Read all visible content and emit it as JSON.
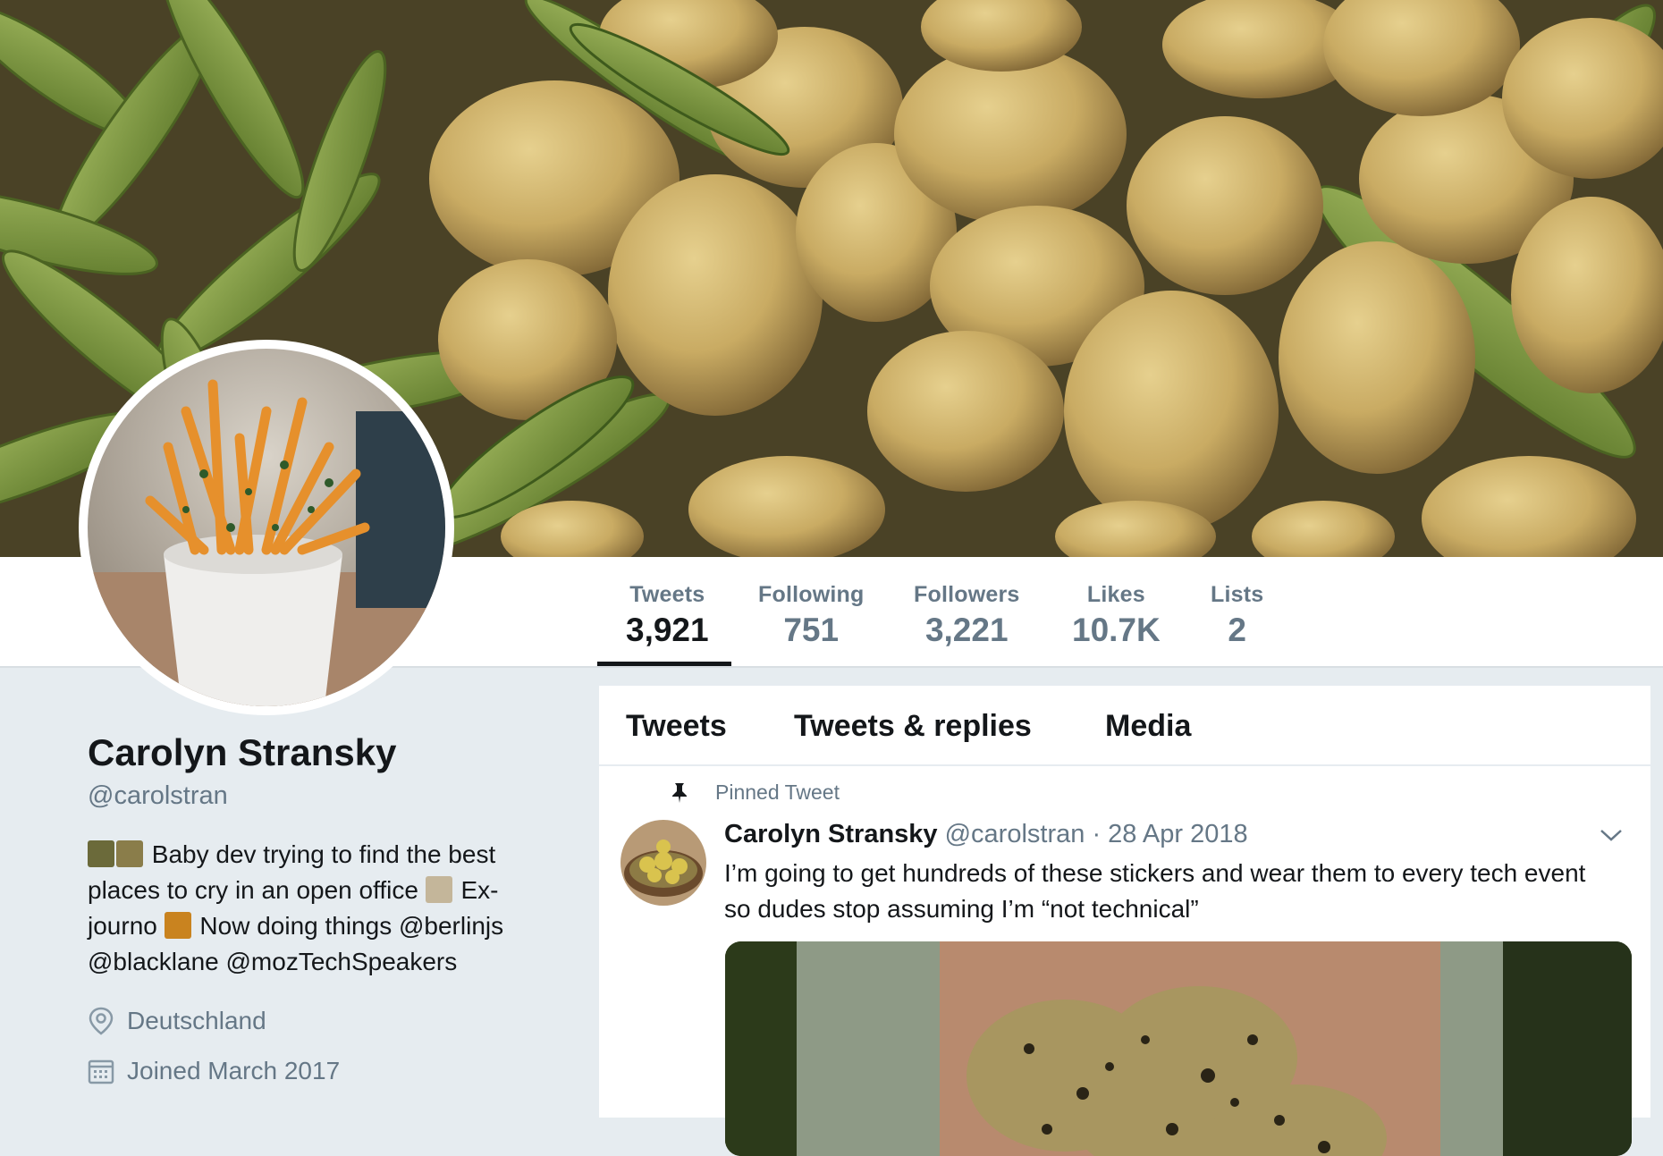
{
  "profile": {
    "name": "Carolyn Stransky",
    "handle": "@carolstran",
    "bio": {
      "line1": "Baby dev trying to find the best",
      "line2a": "places to cry in an open office",
      "line2b": "Ex-",
      "line3a": "journo",
      "line3b": "Now doing things @berlinjs",
      "line4": "@blacklane @mozTechSpeakers"
    },
    "location": "Deutschland",
    "joined": "Joined March 2017"
  },
  "stats": [
    {
      "label": "Tweets",
      "value": "3,921",
      "active": true
    },
    {
      "label": "Following",
      "value": "751"
    },
    {
      "label": "Followers",
      "value": "3,221"
    },
    {
      "label": "Likes",
      "value": "10.7K"
    },
    {
      "label": "Lists",
      "value": "2"
    }
  ],
  "tabs": [
    "Tweets",
    "Tweets & replies",
    "Media"
  ],
  "pinned_tweet": {
    "pinned_label": "Pinned Tweet",
    "author_name": "Carolyn Stransky",
    "author_handle": "@carolstran",
    "date": "· 28 Apr 2018",
    "text_line1": "I’m going to get hundreds of these stickers and wear them to every tech event",
    "text_line2": "so dudes stop assuming I’m “not technical”"
  },
  "icons": {
    "location": "location-pin-icon",
    "joined": "calendar-icon",
    "pinned": "pin-icon",
    "menu": "chevron-down-icon"
  },
  "colors": {
    "text_primary": "#14171a",
    "text_secondary": "#657786",
    "page_background": "#e6ecf0"
  }
}
